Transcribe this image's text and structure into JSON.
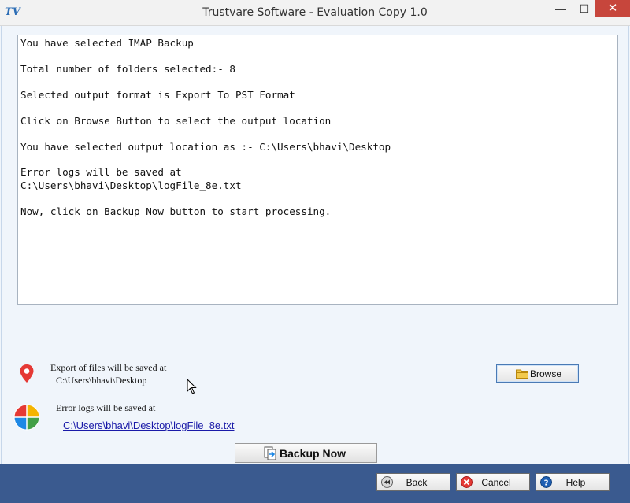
{
  "window": {
    "app_icon_text": "TV",
    "title": "Trustvare Software - Evaluation Copy 1.0",
    "minimize_glyph": "—",
    "maximize_glyph": "☐",
    "close_glyph": "✕"
  },
  "log": {
    "lines": [
      "You have selected IMAP Backup",
      "Total number of folders selected:- 8",
      "Selected output format is Export To PST Format",
      "Click on Browse Button to select the output location",
      "You have selected output location as :- C:\\Users\\bhavi\\Desktop",
      "Error logs will be saved at",
      "C:\\Users\\bhavi\\Desktop\\logFile_8e.txt",
      "Now, click on Backup Now button to start processing."
    ]
  },
  "export": {
    "label": "Export of files will be saved at",
    "path": "C:\\Users\\bhavi\\Desktop",
    "icon": "location-pin-icon"
  },
  "errorlog": {
    "label": "Error logs will be saved at",
    "path": "C:\\Users\\bhavi\\Desktop\\logFile_8e.txt",
    "icon": "pie-chart-icon"
  },
  "buttons": {
    "browse": "Browse",
    "backup_now": "Backup Now",
    "back": "Back",
    "cancel": "Cancel",
    "help": "Help"
  },
  "colors": {
    "bottom_bar": "#3a5a8f",
    "close_button": "#c7463c",
    "link": "#1a1aa8"
  }
}
